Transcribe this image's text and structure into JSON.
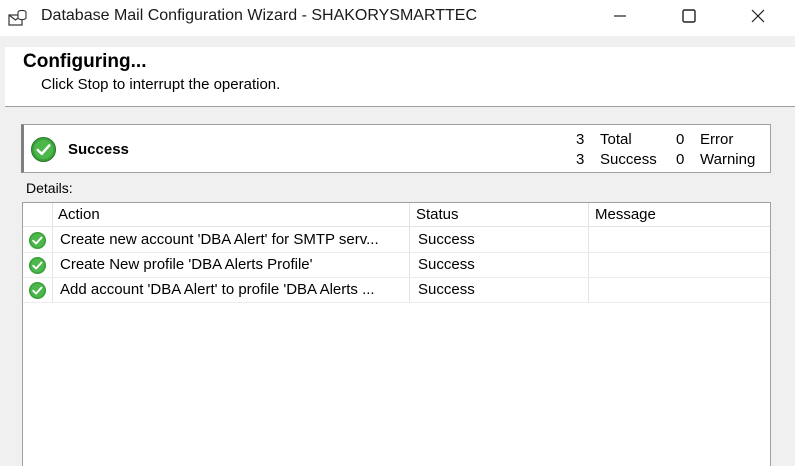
{
  "window": {
    "title": "Database Mail Configuration Wizard - SHAKORYSMARTTEC"
  },
  "header": {
    "title": "Configuring...",
    "subtitle": "Click Stop to interrupt the operation."
  },
  "summary": {
    "status": "Success",
    "total_count": "3",
    "total_label": "Total",
    "success_count": "3",
    "success_label": "Success",
    "error_count": "0",
    "error_label": "Error",
    "warning_count": "0",
    "warning_label": "Warning"
  },
  "details": {
    "label": "Details:",
    "columns": [
      "Action",
      "Status",
      "Message"
    ],
    "rows": [
      {
        "icon": "success-check-icon",
        "action": "Create new account 'DBA Alert' for SMTP serv...",
        "status": "Success",
        "message": ""
      },
      {
        "icon": "success-check-icon",
        "action": "Create New profile 'DBA Alerts Profile'",
        "status": "Success",
        "message": ""
      },
      {
        "icon": "success-check-icon",
        "action": "Add account 'DBA Alert' to profile 'DBA Alerts ...",
        "status": "Success",
        "message": ""
      }
    ]
  },
  "colors": {
    "success_green": "#3aa13a",
    "border": "#a0a0a0"
  }
}
